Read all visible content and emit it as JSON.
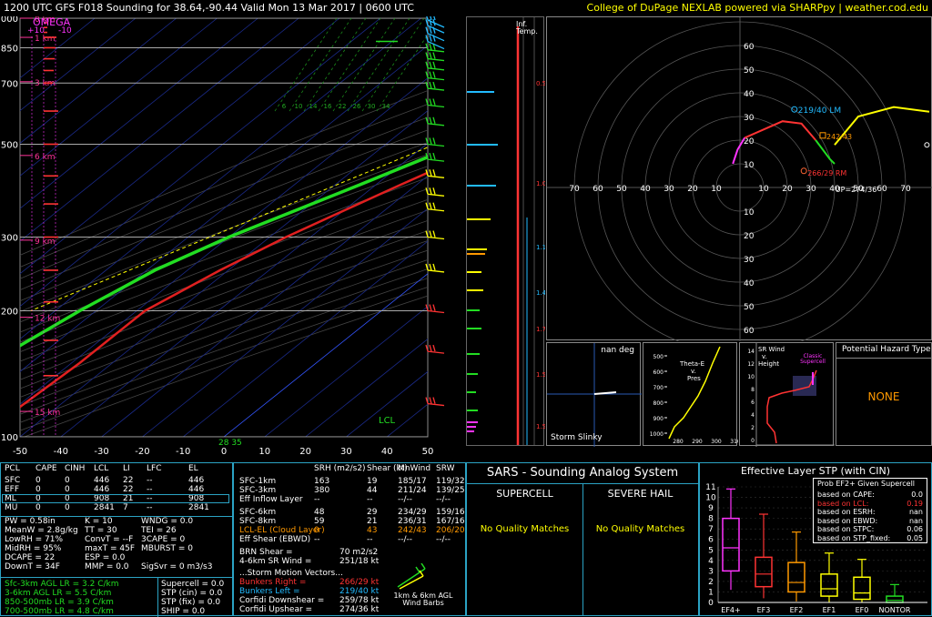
{
  "header": {
    "title": "1200 UTC GFS F018 Sounding for 38.64,-90.44 Valid  Mon 13 Mar 2017 | 0600 UTC",
    "credit": "College of DuPage NEXLAB powered via SHARPpy | weather.cod.edu"
  },
  "colors": {
    "bg": "#000000",
    "temp": "#e02020",
    "dewpoint": "#22dd22",
    "wetbulb": "#22bbff",
    "isobar": "#aaaaaa",
    "panel_border": "#2ba3c4",
    "yellow": "#ffff00",
    "magenta": "#ff33ff",
    "orange": "#ff9900"
  },
  "skewt": {
    "omega_label": "OMEGA",
    "omega_ticks": [
      "+10",
      "-10"
    ],
    "pressure_labels": [
      "100",
      "200",
      "300",
      "500",
      "700",
      "850",
      "1000"
    ],
    "temp_labels": [
      "-50",
      "-40",
      "-30",
      "-20",
      "-10",
      "0",
      "10",
      "20",
      "30",
      "40",
      "50"
    ],
    "height_labels": [
      "15 km",
      "12 km",
      "9 km",
      "6 km",
      "3 km",
      "1 km",
      "0 km"
    ],
    "mixing_ratio_labels": [
      "6",
      "10",
      "14",
      "16",
      "22",
      "26",
      "30",
      "34"
    ],
    "lcl_label": "LCL",
    "sfc_readout": "28  35"
  },
  "chart_data": {
    "type": "line",
    "title": "1200 UTC GFS F018 Sounding for 38.64,-90.44 Valid  Mon 13 Mar 2017 | 0600 UTC",
    "xlabel": "",
    "ylabel": "",
    "yscale": "log pressure",
    "ylim": [
      1000,
      100
    ],
    "xlim": [
      -50,
      50
    ],
    "series": [
      {
        "name": "",
        "color": "#e02020",
        "points": [
          [
            1000,
            3
          ],
          [
            950,
            0
          ],
          [
            900,
            -2
          ],
          [
            850,
            -4
          ],
          [
            800,
            -6
          ],
          [
            700,
            -10
          ],
          [
            600,
            -16
          ],
          [
            500,
            -24
          ],
          [
            400,
            -34
          ],
          [
            300,
            -46
          ],
          [
            250,
            -52
          ],
          [
            200,
            -58
          ],
          [
            150,
            -58
          ],
          [
            100,
            -60
          ]
        ]
      },
      {
        "name": "",
        "color": "#22dd22",
        "points": [
          [
            1000,
            -5
          ],
          [
            950,
            -7
          ],
          [
            900,
            -9
          ],
          [
            850,
            -10
          ],
          [
            800,
            -11
          ],
          [
            700,
            -14
          ],
          [
            600,
            -22
          ],
          [
            500,
            -32
          ],
          [
            400,
            -44
          ],
          [
            300,
            -60
          ],
          [
            250,
            -68
          ],
          [
            200,
            -74
          ],
          [
            150,
            -80
          ],
          [
            100,
            -82
          ]
        ]
      }
    ]
  },
  "inflow": {
    "title": "Inf. Temp.",
    "ticks": [
      "-0.5",
      "-1.0",
      "-1.1",
      "-1.4",
      "-1.7",
      "-1.5",
      "-1.5"
    ]
  },
  "hodograph": {
    "rings": [
      "10",
      "20",
      "30",
      "40",
      "50",
      "60",
      "70"
    ],
    "labels": {
      "lm": "219/40 LM",
      "rm": "266/29 RM",
      "up": "UP=274/36",
      "mean": "242/43",
      "d": "D"
    }
  },
  "small_panels": {
    "storm_slinky": {
      "title": "Storm Slinky",
      "value": "nan deg"
    },
    "theta_e": {
      "title_lines": [
        "Theta-E",
        "v.",
        "Pres"
      ],
      "p_labels": [
        "500",
        "600",
        "700",
        "800",
        "900",
        "1000"
      ],
      "x_labels": [
        "280",
        "290",
        "300",
        "310"
      ]
    },
    "sr_wind": {
      "title_lines": [
        "SR Wind",
        "v.",
        "Height"
      ],
      "label": "Classic Supercell",
      "h_labels": [
        "14",
        "12",
        "10",
        "8",
        "6",
        "4",
        "2",
        "0"
      ]
    },
    "hazard": {
      "title": "Potential Hazard Type",
      "value": "NONE"
    }
  },
  "parcels": {
    "header": [
      "PCL",
      "CAPE",
      "CINH",
      "LCL",
      "LI",
      "LFC",
      "EL"
    ],
    "rows": [
      [
        "SFC",
        "0",
        "0",
        "446",
        "22",
        "--",
        "446"
      ],
      [
        "EFF",
        "0",
        "0",
        "446",
        "22",
        "--",
        "446"
      ],
      [
        "ML",
        "0",
        "0",
        "908",
        "21",
        "--",
        "908"
      ],
      [
        "MU",
        "0",
        "0",
        "2841",
        "7",
        "--",
        "2841"
      ]
    ]
  },
  "indices": [
    [
      "PW = 0.58in",
      "K = 10",
      "WNDG = 0.0"
    ],
    [
      "MeanW = 2.8g/kg",
      "TT = 30",
      "TEI = 26"
    ],
    [
      "LowRH = 71%",
      "ConvT = --F",
      "3CAPE = 0"
    ],
    [
      "MidRH = 95%",
      "maxT = 45F",
      "MBURST = 0"
    ],
    [
      "DCAPE = 22",
      "ESP = 0.0",
      ""
    ],
    [
      "DownT = 34F",
      "MMP = 0.0",
      "SigSvr = 0 m3/s3"
    ]
  ],
  "lapse_rates": [
    "Sfc-3km AGL LR = 3.2 C/km",
    "3-6km AGL LR = 5.5 C/km",
    "850-500mb LR = 3.9 C/km",
    "700-500mb LR = 4.8 C/km"
  ],
  "composites": [
    "Supercell = 0.0",
    "STP (cin) = 0.0",
    "STP (fix) = 0.0",
    "SHIP = 0.0"
  ],
  "kinematics": {
    "header": [
      "",
      "SRH (m2/s2)",
      "Shear (kt)",
      "MnWind",
      "SRW"
    ],
    "rows": [
      [
        "SFC-1km",
        "163",
        "19",
        "185/17",
        "119/32"
      ],
      [
        "SFC-3km",
        "380",
        "44",
        "211/24",
        "139/25"
      ],
      [
        "Eff Inflow Layer",
        "--",
        "--",
        "--/--",
        "--/--"
      ],
      [
        "SFC-6km",
        "48",
        "29",
        "234/29",
        "159/16"
      ],
      [
        "SFC-8km",
        "59",
        "21",
        "236/31",
        "167/16"
      ],
      [
        "LCL-EL (Cloud Layer)",
        "0",
        "43",
        "242/43",
        "206/20"
      ],
      [
        "Eff Shear (EBWD)",
        "--",
        "--",
        "--/--",
        "--/--"
      ]
    ],
    "brn_shear": "BRN Shear =",
    "brn_shear_val": "70 m2/s2",
    "sr_wind": "4-6km SR Wind =",
    "sr_wind_val": "251/18 kt",
    "vectors_title": "...Storm Motion Vectors...",
    "vectors": [
      [
        "Bunkers Right =",
        "266/29 kt"
      ],
      [
        "Bunkers Left =",
        "219/40 kt"
      ],
      [
        "Corfidi Downshear =",
        "259/78 kt"
      ],
      [
        "Corfidi Upshear =",
        "274/36 kt"
      ]
    ],
    "barbs_label": "1km & 6km AGL Wind Barbs"
  },
  "sars": {
    "title": "SARS - Sounding Analog System",
    "supercell": "SUPERCELL",
    "hail": "SEVERE HAIL",
    "no_match": "No Quality Matches"
  },
  "stp": {
    "title": "Effective Layer STP (with CIN)",
    "prob_title": "Prob EF2+ Given Supercell",
    "probs": [
      [
        "based on CAPE:",
        "0.0"
      ],
      [
        "based on LCL:",
        "0.19"
      ],
      [
        "based on ESRH:",
        "nan"
      ],
      [
        "based on EBWD:",
        "nan"
      ],
      [
        "based on STPC:",
        "0.06"
      ],
      [
        "based on STP_fixed:",
        "0.05"
      ]
    ],
    "y_labels": [
      "11",
      "10",
      "9",
      "8",
      "7",
      "6",
      "5",
      "4",
      "3",
      "2",
      "1",
      "0"
    ],
    "categories": [
      "EF4+",
      "EF3",
      "EF2",
      "EF1",
      "EF0",
      "NONTOR"
    ]
  }
}
